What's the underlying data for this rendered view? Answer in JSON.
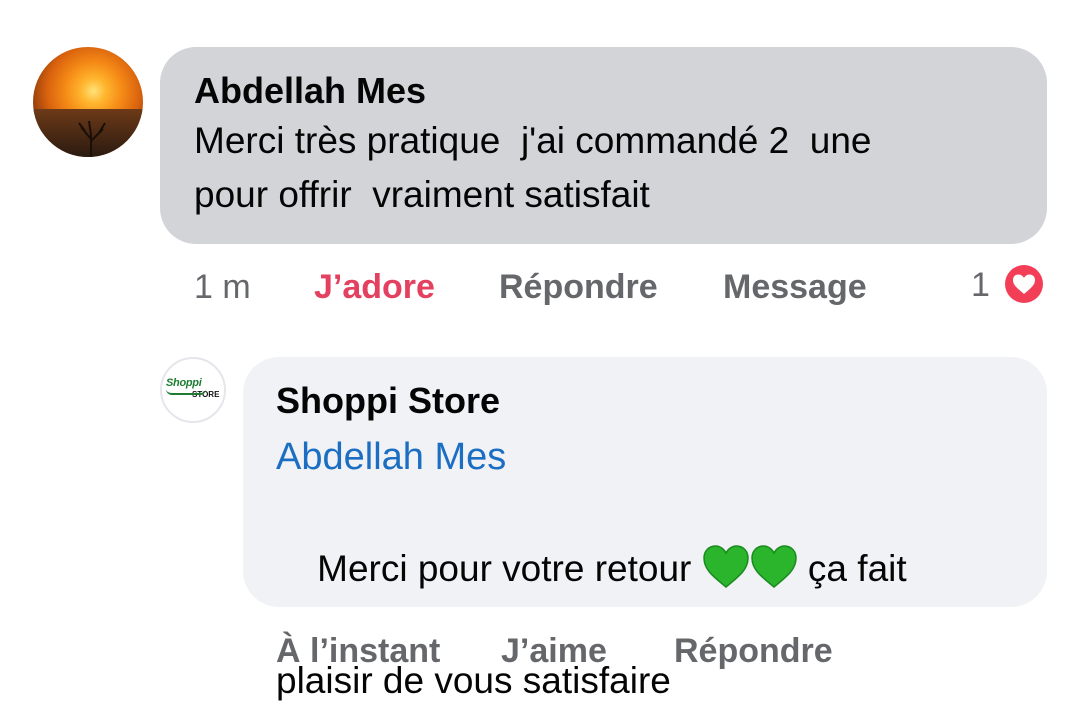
{
  "comment": {
    "author": "Abdellah Mes",
    "text_line1": "Merci très pratique  j'ai commandé 2  une",
    "text_line2": "pour offrir  vraiment satisfait",
    "time": "1 m",
    "reaction_label": "J’adore",
    "reply_label": "Répondre",
    "message_label": "Message",
    "reaction_count": "1",
    "reaction_icon": "heart-icon",
    "reaction_color": "#f33e58"
  },
  "reply": {
    "author": "Shoppi Store",
    "avatar_brand": "Shoppi",
    "avatar_brand_sub": "STORE",
    "mention": "Abdellah Mes",
    "text_part1": "Merci pour votre retour ",
    "text_part2": " ça fait",
    "text_line2": "plaisir de vous satisfaire",
    "emoji": "green-heart-icon",
    "time": "À l’instant",
    "like_label": "J’aime",
    "reply_label": "Répondre"
  },
  "colors": {
    "bubble_primary": "#d2d4d8",
    "bubble_reply": "#f0f2f5",
    "mention": "#1b6ec2",
    "love": "#e4405f",
    "action_text": "#65676b"
  }
}
